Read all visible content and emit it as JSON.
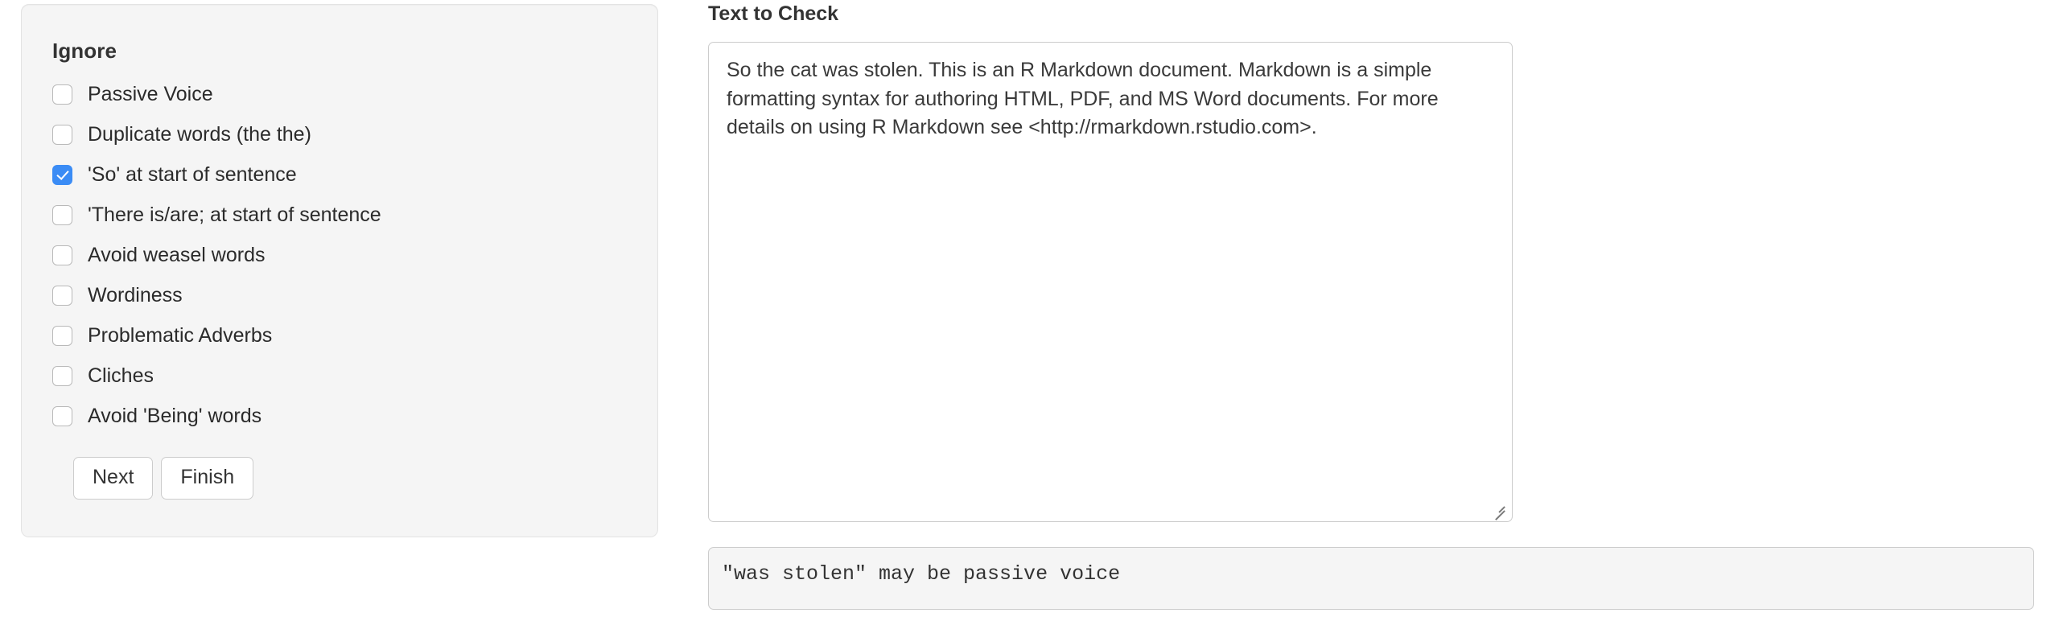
{
  "sidebar": {
    "title": "Ignore",
    "checks": [
      {
        "label": "Passive Voice",
        "checked": false
      },
      {
        "label": "Duplicate words (the the)",
        "checked": false
      },
      {
        "label": "'So' at start of sentence",
        "checked": true
      },
      {
        "label": "'There is/are; at start of sentence",
        "checked": false
      },
      {
        "label": "Avoid weasel words",
        "checked": false
      },
      {
        "label": "Wordiness",
        "checked": false
      },
      {
        "label": "Problematic Adverbs",
        "checked": false
      },
      {
        "label": "Cliches",
        "checked": false
      },
      {
        "label": "Avoid 'Being' words",
        "checked": false
      }
    ],
    "buttons": {
      "next_label": "Next",
      "finish_label": "Finish"
    }
  },
  "main": {
    "label": "Text to Check",
    "textarea_value": "So the cat was stolen. This is an R Markdown document. Markdown is a simple formatting syntax for authoring HTML, PDF, and MS Word documents. For more details on using R Markdown see <http://rmarkdown.rstudio.com>.",
    "textarea_placeholder": "",
    "output_text": "\"was stolen\" may be passive voice"
  },
  "colors": {
    "accent": "#3b8cf5",
    "panel_bg": "#f5f5f5",
    "panel_border": "#e3e3e3",
    "control_border": "#cccccc",
    "text": "#333333"
  }
}
